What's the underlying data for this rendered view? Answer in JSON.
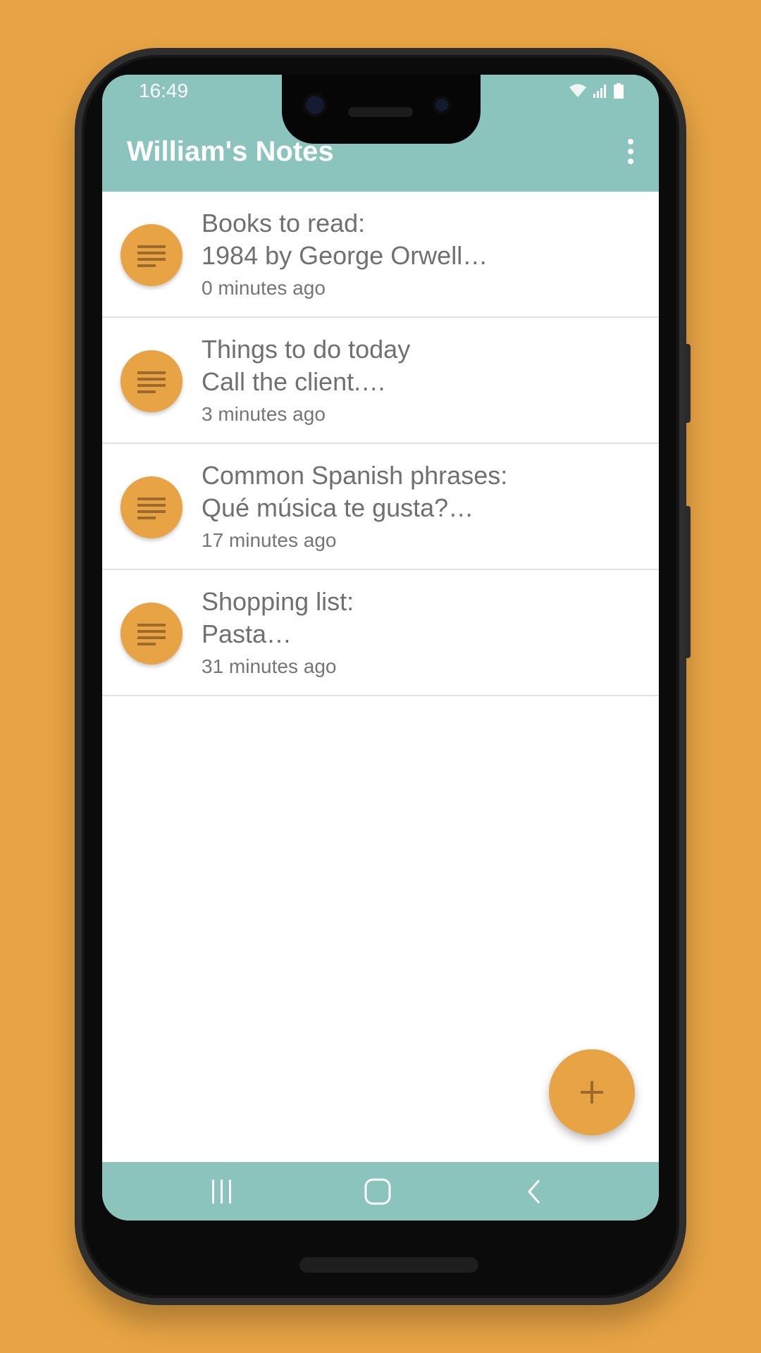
{
  "status_bar": {
    "time": "16:49"
  },
  "app_bar": {
    "title": "William's Notes",
    "overflow_icon": "more-vert-icon"
  },
  "notes": [
    {
      "line1": "Books to read:",
      "line2": "1984 by George Orwell…",
      "time": "0 minutes ago",
      "icon": "notes-icon"
    },
    {
      "line1": "Things to do today",
      "line2": "Call the client.…",
      "time": "3 minutes ago",
      "icon": "notes-icon"
    },
    {
      "line1": "Common Spanish phrases:",
      "line2": "Qué música te gusta?…",
      "time": "17 minutes ago",
      "icon": "notes-icon"
    },
    {
      "line1": "Shopping list:",
      "line2": "Pasta…",
      "time": "31 minutes ago",
      "icon": "notes-icon"
    }
  ],
  "fab": {
    "icon": "add-icon"
  },
  "nav_bar": {
    "icons": [
      "recents-icon",
      "home-icon",
      "back-icon"
    ]
  },
  "colors": {
    "background": "#E8A444",
    "app_bar": "#8AC4BC",
    "accent": "#E8A444",
    "text": "#707070"
  }
}
